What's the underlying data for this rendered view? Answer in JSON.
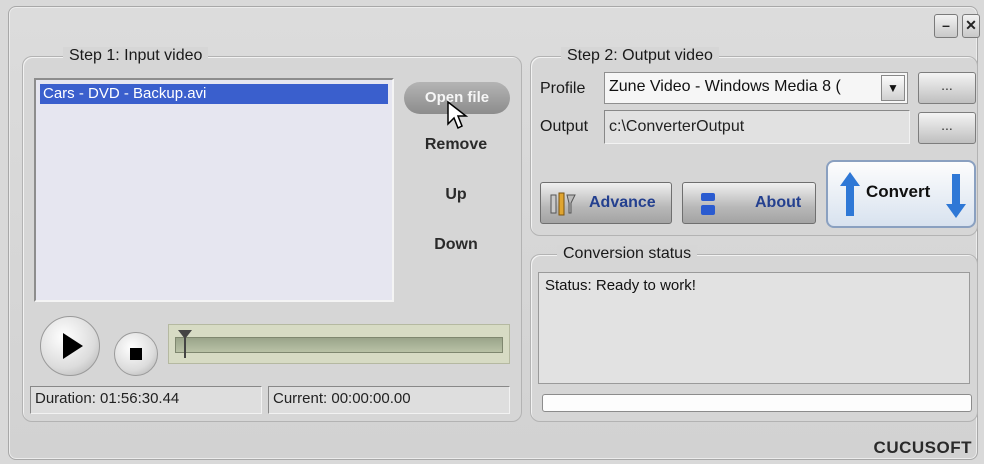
{
  "window": {
    "minimize_label": "–",
    "close_label": "✕"
  },
  "input_group": {
    "legend": "Step 1: Input video",
    "files": [
      "Cars - DVD - Backup.avi"
    ],
    "open_file_label": "Open file",
    "remove_label": "Remove",
    "up_label": "Up",
    "down_label": "Down",
    "duration_text": "Duration: 01:56:30.44",
    "current_text": "Current: 00:00:00.00",
    "seek_position": 0
  },
  "output_group": {
    "legend": "Step 2: Output video",
    "profile_label": "Profile",
    "profile_value": "Zune Video - Windows Media 8 (",
    "output_label": "Output",
    "output_value": "c:\\ConverterOutput",
    "browse_label": "...",
    "advance_label": "Advance",
    "about_label": "About",
    "convert_label": "Convert"
  },
  "status_group": {
    "legend": "Conversion status",
    "status_text": "Status: Ready to work!",
    "progress": 0
  },
  "brand": "CUCUSOFT",
  "colors": {
    "selection": "#3a5fcd",
    "convert_arrow": "#2f78d6",
    "about_icon": "#2a5bd0"
  }
}
